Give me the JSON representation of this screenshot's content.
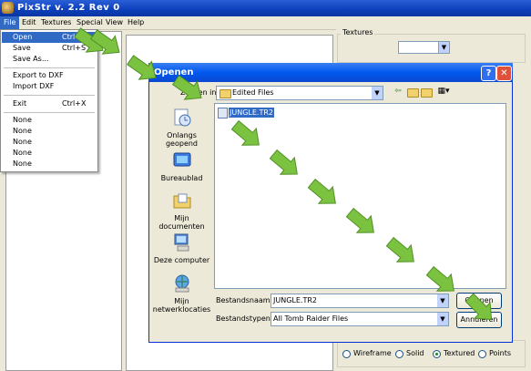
{
  "app": {
    "title": "PixStr v. 2.2 Rev 0",
    "menu": [
      "File",
      "Edit",
      "Textures",
      "Special",
      "View",
      "Help"
    ]
  },
  "file_menu": {
    "items": [
      {
        "label": "Open",
        "shortcut": "Ctrl+O"
      },
      {
        "label": "Save",
        "shortcut": "Ctrl+S"
      },
      {
        "label": "Save As...",
        "shortcut": ""
      },
      {
        "label": "Export to DXF",
        "shortcut": ""
      },
      {
        "label": "Import DXF",
        "shortcut": ""
      },
      {
        "label": "Exit",
        "shortcut": "Ctrl+X"
      },
      {
        "label": "None",
        "shortcut": ""
      },
      {
        "label": "None",
        "shortcut": ""
      },
      {
        "label": "None",
        "shortcut": ""
      },
      {
        "label": "None",
        "shortcut": ""
      },
      {
        "label": "None",
        "shortcut": ""
      }
    ]
  },
  "right_panel": {
    "textures_label": "Textures",
    "view_options": [
      {
        "label": "Wireframe",
        "selected": false
      },
      {
        "label": "Solid",
        "selected": false
      },
      {
        "label": "Textured",
        "selected": true
      },
      {
        "label": "Points",
        "selected": false
      }
    ]
  },
  "dialog": {
    "title": "Openen",
    "look_in_label": "Zoeken in:",
    "look_in_value": "Edited Files",
    "places": [
      "Onlangs geopend",
      "Bureaublad",
      "Mijn documenten",
      "Deze computer",
      "Mijn netwerklocaties"
    ],
    "files": [
      "JUNGLE.TR2"
    ],
    "filename_label": "Bestandsnaam:",
    "filename_value": "JUNGLE.TR2",
    "filetype_label": "Bestandstypen:",
    "filetype_value": "All Tomb Raider Files",
    "open_button": "Openen",
    "cancel_button": "Annuleren"
  },
  "colors": {
    "arrow": "#7cc241",
    "title_blue": "#0058ee",
    "selection": "#316ac5"
  }
}
